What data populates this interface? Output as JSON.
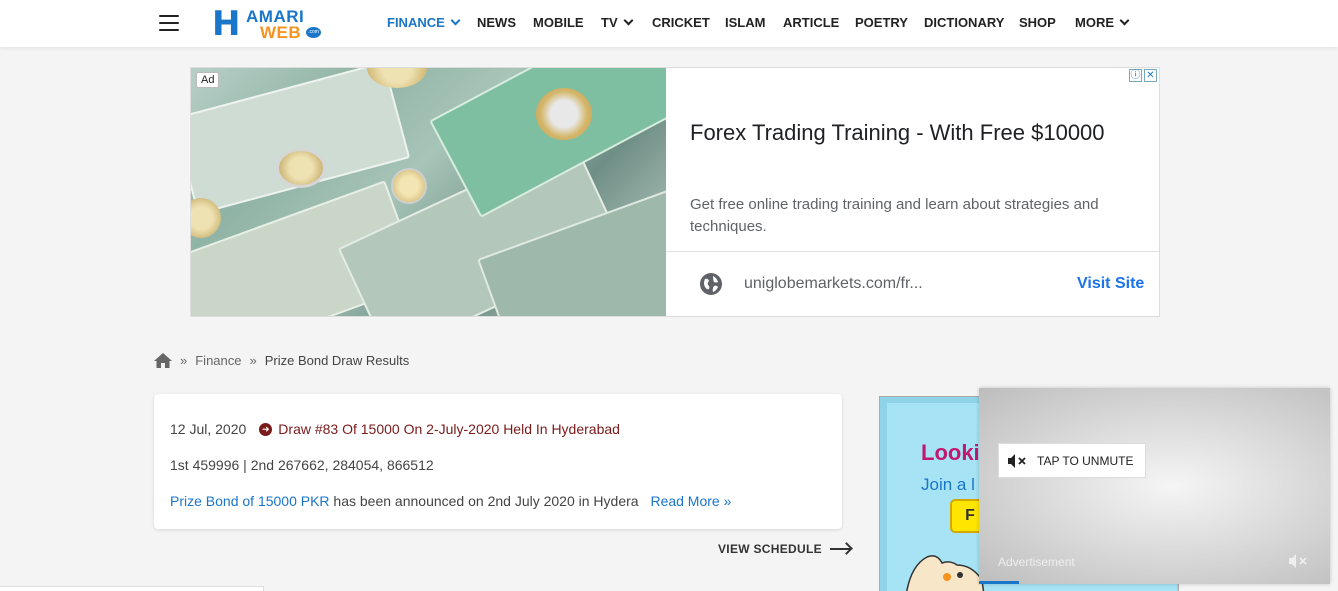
{
  "header": {
    "logo_text": {
      "h": "H",
      "amari": "AMARI",
      "web": "WEB",
      "dotcom": ".com"
    },
    "nav": [
      {
        "label": "FINANCE",
        "active": true,
        "dropdown": true
      },
      {
        "label": "NEWS"
      },
      {
        "label": "MOBILE"
      },
      {
        "label": "TV",
        "dropdown": true
      },
      {
        "label": "CRICKET"
      },
      {
        "label": "ISLAM"
      },
      {
        "label": "ARTICLE"
      },
      {
        "label": "POETRY"
      },
      {
        "label": "DICTIONARY"
      },
      {
        "label": "SHOP"
      },
      {
        "label": "MORE",
        "dropdown": true
      }
    ]
  },
  "ad": {
    "label": "Ad",
    "title": "Forex Trading Training - With Free $10000",
    "description": "Get free online trading training and learn about strategies and techniques.",
    "domain": "uniglobemarkets.com/fr...",
    "cta": "Visit Site",
    "choice_info": "ⓘ",
    "choice_close": "✕"
  },
  "breadcrumb": {
    "sep": "»",
    "items": [
      "Finance",
      "Prize Bond Draw Results"
    ]
  },
  "card": {
    "date": "12 Jul, 2020",
    "draw_title": "Draw #83 Of 15000 On 2-July-2020 Held In Hyderabad",
    "results": "1st 459996 | 2nd 267662, 284054, 866512",
    "summary_link": "Prize Bond of 15000 PKR",
    "summary_rest": " has been announced on 2nd July 2020 in Hydera",
    "read_more": "Read More »"
  },
  "view_schedule": "VIEW SCHEDULE",
  "side_ad": {
    "looking": "Looki",
    "join": "Join a l",
    "button": "F"
  },
  "video": {
    "unmute": "TAP TO UNMUTE",
    "ad_label": "Advertisement"
  },
  "colors": {
    "brand_blue": "#1a76c8",
    "brand_orange": "#f7931e",
    "draw_link": "#7a1a1a",
    "visit_site": "#1a73e8"
  }
}
